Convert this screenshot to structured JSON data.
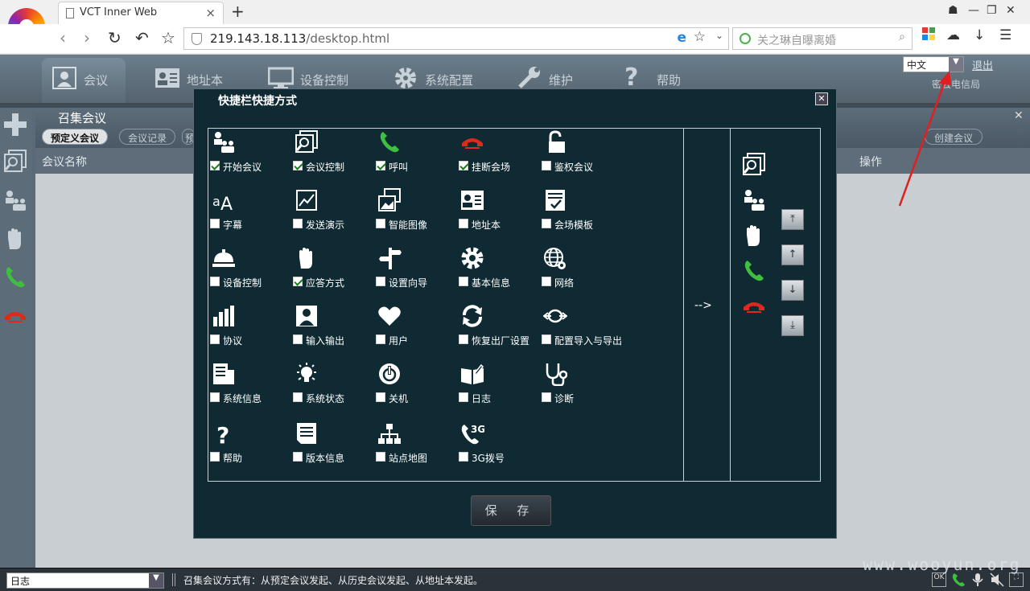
{
  "browser": {
    "tab_title": "VCT Inner Web",
    "url_host": "219.143.18.113",
    "url_path": "/desktop.html",
    "search_placeholder": "关之琳自曝离婚"
  },
  "app": {
    "main_tabs": [
      "会议",
      "地址本",
      "设备控制",
      "系统配置",
      "维护",
      "帮助"
    ],
    "language": "中文",
    "logout": "退出",
    "org": "密云电信局",
    "content_title": "召集会议",
    "sub_tabs": [
      "预定义会议",
      "会议记录",
      "预"
    ],
    "create_meeting": "创建会议",
    "columns": [
      "会议名称",
      "操作"
    ],
    "status_log": "日志",
    "status_text": "召集会议方式有：从预定会议发起、从历史会议发起、从地址本发起。",
    "status_icon_ok": "OK"
  },
  "dialog": {
    "title": "快捷栏快捷方式",
    "move_arrow": "-->",
    "save": "保 存",
    "items": [
      {
        "label": "开始会议",
        "icon": "start-meeting-icon",
        "checked": true
      },
      {
        "label": "会议控制",
        "icon": "meeting-control-icon",
        "checked": true
      },
      {
        "label": "呼叫",
        "icon": "call-icon",
        "checked": true
      },
      {
        "label": "挂断会场",
        "icon": "hangup-icon",
        "checked": true
      },
      {
        "label": "鉴权会议",
        "icon": "lock-icon",
        "checked": false
      },
      {
        "label": "字幕",
        "icon": "subtitle-icon",
        "checked": false
      },
      {
        "label": "发送演示",
        "icon": "presentation-icon",
        "checked": false
      },
      {
        "label": "智能图像",
        "icon": "smart-image-icon",
        "checked": false
      },
      {
        "label": "地址本",
        "icon": "address-book-icon",
        "checked": false
      },
      {
        "label": "会场模板",
        "icon": "template-icon",
        "checked": false
      },
      {
        "label": "设备控制",
        "icon": "device-control-icon",
        "checked": false
      },
      {
        "label": "应答方式",
        "icon": "hand-icon",
        "checked": true
      },
      {
        "label": "设置向导",
        "icon": "signpost-icon",
        "checked": false
      },
      {
        "label": "基本信息",
        "icon": "gear-icon",
        "checked": false
      },
      {
        "label": "网络",
        "icon": "network-icon",
        "checked": false
      },
      {
        "label": "协议",
        "icon": "protocol-icon",
        "checked": false
      },
      {
        "label": "输入输出",
        "icon": "io-icon",
        "checked": false
      },
      {
        "label": "用户",
        "icon": "heart-icon",
        "checked": false
      },
      {
        "label": "恢复出厂设置",
        "icon": "reset-icon",
        "checked": false
      },
      {
        "label": "配置导入与导出",
        "icon": "import-export-icon",
        "checked": false
      },
      {
        "label": "系统信息",
        "icon": "sysinfo-icon",
        "checked": false
      },
      {
        "label": "系统状态",
        "icon": "bulb-icon",
        "checked": false
      },
      {
        "label": "关机",
        "icon": "power-icon",
        "checked": false
      },
      {
        "label": "日志",
        "icon": "book-icon",
        "checked": false
      },
      {
        "label": "诊断",
        "icon": "stethoscope-icon",
        "checked": false
      },
      {
        "label": "帮助",
        "icon": "help-icon",
        "checked": false
      },
      {
        "label": "版本信息",
        "icon": "version-icon",
        "checked": false
      },
      {
        "label": "站点地图",
        "icon": "sitemap-icon",
        "checked": false
      },
      {
        "label": "3G拨号",
        "icon": "dial-3g-icon",
        "checked": false
      }
    ],
    "selected_icons": [
      "meeting-control-icon",
      "start-meeting-icon",
      "hand-icon",
      "call-icon",
      "hangup-icon"
    ]
  },
  "watermark": "www.wooyun.org",
  "colors": {
    "dialog_bg": "#0f2a33",
    "call_green": "#3fbf3f",
    "hangup_red": "#e0281e"
  }
}
